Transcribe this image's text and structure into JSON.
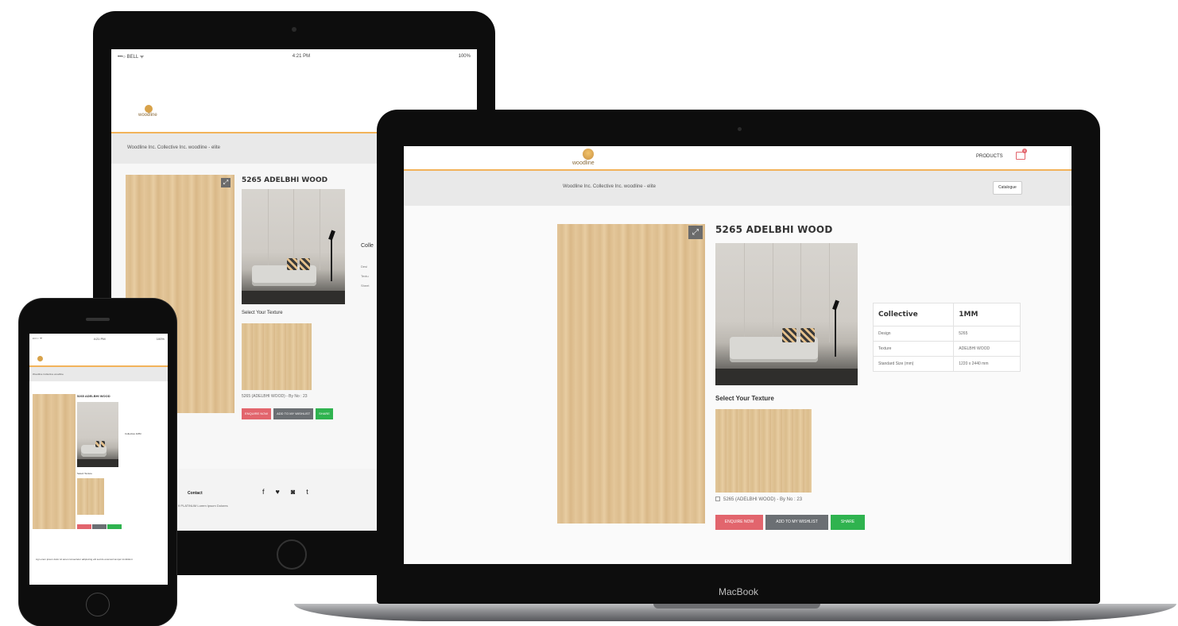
{
  "tablet": {
    "status_left": "•••○ BELL ᯤ",
    "status_time": "4:21 PM",
    "status_right": "100%",
    "logo_text": "woodline",
    "breadcrumb": "Woodline Inc.   Collective Inc.   woodline - elite",
    "product_title": "5265 ADELBHI WOOD",
    "select_texture_label": "Select Your Texture",
    "texture_option": "5265 (ADELBHI WOOD) - By No : 23",
    "collection_heading": "Colle",
    "collection_rows": [
      "Desi",
      "Textu",
      "Sheet"
    ],
    "buttons": {
      "enquire": "ENQUIRE NOW",
      "wishlist": "ADD TO MY WISHLIST",
      "share": "SHARE"
    },
    "footer_contact": "Contact",
    "footer_sub": "9 PLATINUM Lorem Ipsum Dolores",
    "social_icons": [
      "facebook-icon",
      "twitter-icon",
      "instagram-icon",
      "tumblr-icon"
    ]
  },
  "laptop": {
    "brand": "MacBook",
    "logo_text": "woodline",
    "nav_products": "PRODUCTS",
    "cart_count": "0",
    "breadcrumb": "Woodline Inc.    Collective Inc.    woodline - elite",
    "catalogue_button": "Catalogue",
    "product_title": "5265 ADELBHI WOOD",
    "select_texture_label": "Select Your Texture",
    "texture_option": "5265 (ADELBHI WOOD) - By No : 23",
    "buttons": {
      "enquire": "ENQUIRE NOW",
      "wishlist": "ADD TO MY WISHLIST",
      "share": "SHARE"
    },
    "spec_table": {
      "heading_left": "Collective",
      "heading_right": "1MM",
      "rows": [
        {
          "label": "Design",
          "value": "5265"
        },
        {
          "label": "Texture",
          "value": "ADELBHI WOOD"
        },
        {
          "label": "Standard Size (mm)",
          "value": "1220 x 2440 mm"
        }
      ]
    }
  },
  "phone": {
    "status_left": "••○○ ᯤ",
    "status_time": "4:21 PM",
    "status_right": "100%",
    "breadcrumb": "Woodline   Collective   woodline",
    "product_title": "5265 ADELBHI WOOD",
    "select_texture_label": "Select Texture",
    "collection_heading": "Collective   1MM",
    "footer_text": "Ag Lorem ipsum dolor sit amet consectetur adipiscing elit sed do eiusmod tempor incididunt"
  },
  "colors": {
    "accent_orange": "#f2b35a",
    "enquire_red": "#e2656d",
    "wishlist_gray": "#6b6f73",
    "share_green": "#2fb34f"
  }
}
